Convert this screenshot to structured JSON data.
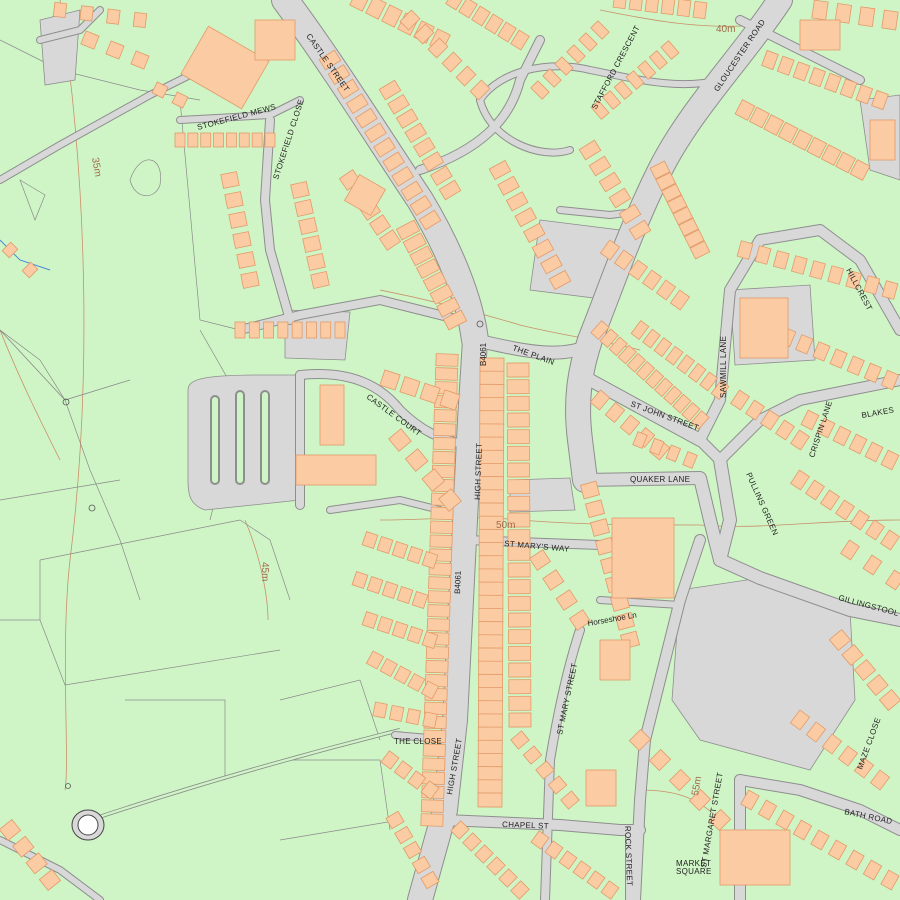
{
  "map": {
    "background_color": "#cff5c6",
    "building_color": "#fbcba3",
    "road_color": "#d8d8d8",
    "contour_color": "#c98f6a"
  },
  "streets": {
    "castle_street": "CASTLE STREET",
    "stokefield_mews": "STOKEFIELD MEWS",
    "stokefield_close": "STOKEFIELD CLOSE",
    "stafford_crescent": "STAFFORD CRESCENT",
    "gloucester_road": "GLOUCESTER ROAD",
    "the_plain": "THE PLAIN",
    "b4061_north": "B4061",
    "b4061_south": "B4061",
    "castle_court": "CASTLE COURT",
    "high_street_north": "HIGH STREET",
    "high_street_south": "HIGH STREET",
    "st_john_street": "ST JOHN STREET",
    "sawmill_lane": "SAWMILL LANE",
    "hillcrest": "HILLCREST",
    "crispin_lane": "CRISPIN LANE",
    "blakes": "BLAKES",
    "quaker_lane": "QUAKER LANE",
    "pullins_green": "PULLINS GREEN",
    "st_marys_way": "ST MARY'S WAY",
    "gillingstool": "GILLINGSTOOL",
    "horseshoe_ln": "Horseshoe Ln",
    "st_mary_street": "ST MARY STREET",
    "the_close": "THE CLOSE",
    "chapel_st": "CHAPEL ST",
    "rock_street": "ROCK STREET",
    "st_margaret_street": "ST MARGARET STREET",
    "bath_road": "BATH ROAD",
    "maze_close": "MAZE CLOSE",
    "market_square": "MARKET",
    "square": "SQUARE"
  },
  "contours": {
    "c35": "35m",
    "c40_top": "40m",
    "c45": "45m",
    "c50": "50m",
    "c55": "55m"
  }
}
